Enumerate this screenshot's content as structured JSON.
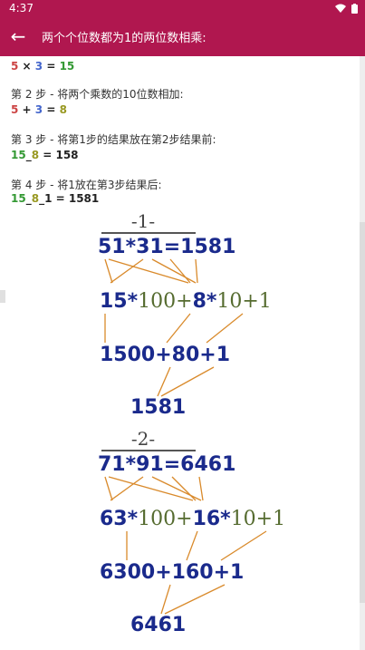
{
  "status_bar": {
    "time": "4:37"
  },
  "app_bar": {
    "title": "两个个位数都为1的两位数相乘:"
  },
  "steps": {
    "s1_formula": {
      "a": "5",
      "op": " × ",
      "b": "3",
      "eq": " = ",
      "r": "15"
    },
    "s2_label": "第 2 步 - 将两个乘数的10位数相加:",
    "s2_formula": {
      "a": "5",
      "op": " + ",
      "b": "3",
      "eq": " = ",
      "r": "8"
    },
    "s3_label": "第 3 步 - 将第1步的结果放在第2步结果前:",
    "s3_formula": {
      "a": "15",
      "sep": "_",
      "b": "8",
      "eq": " = ",
      "r": "158"
    },
    "s4_label": "第 4 步 - 将1放在第3步结果后:",
    "s4_formula": {
      "a": "15",
      "s1": "_",
      "b": "8",
      "s2": "_",
      "c": "1",
      "eq": " = ",
      "r": "1581"
    }
  },
  "examples": [
    {
      "label": "-1-",
      "equation": "51*31=1581",
      "expansion": {
        "a": "15*",
        "b": "100+",
        "c": "8*",
        "d": "10+1"
      },
      "middle": "1500+80+1",
      "result": "1581"
    },
    {
      "label": "-2-",
      "equation": "71*91=6461",
      "expansion": {
        "a": "63*",
        "b": "100+",
        "c": "16*",
        "d": "10+1"
      },
      "middle": "6300+160+1",
      "result": "6461"
    }
  ],
  "colors": {
    "app_bar": "#b0174f",
    "navy": "#1a2a8c",
    "arrow": "#d98a2b"
  },
  "icons": {
    "back": "arrow-left-icon",
    "wifi": "wifi-icon",
    "battery": "battery-icon"
  }
}
